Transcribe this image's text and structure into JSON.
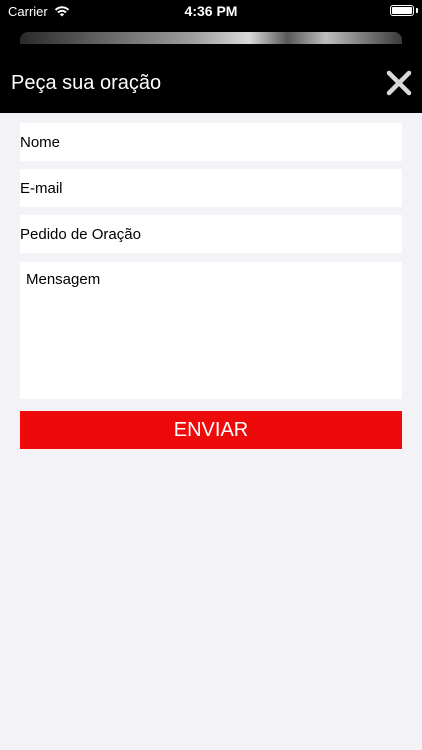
{
  "status_bar": {
    "carrier": "Carrier",
    "time": "4:36 PM",
    "wifi_icon": "wifi-icon",
    "battery_icon": "battery-icon"
  },
  "header": {
    "title": "Peça sua oração",
    "close_icon": "close-icon"
  },
  "form": {
    "fields": [
      {
        "label": "Nome"
      },
      {
        "label": "E-mail"
      },
      {
        "label": "Pedido de Oração"
      }
    ],
    "message_label": "Mensagem",
    "submit_label": "ENVIAR"
  },
  "colors": {
    "header_bg": "#000000",
    "page_bg": "#f2f2f7",
    "button_bg": "#ee0a0a",
    "close_icon": "#d9d9d9"
  }
}
